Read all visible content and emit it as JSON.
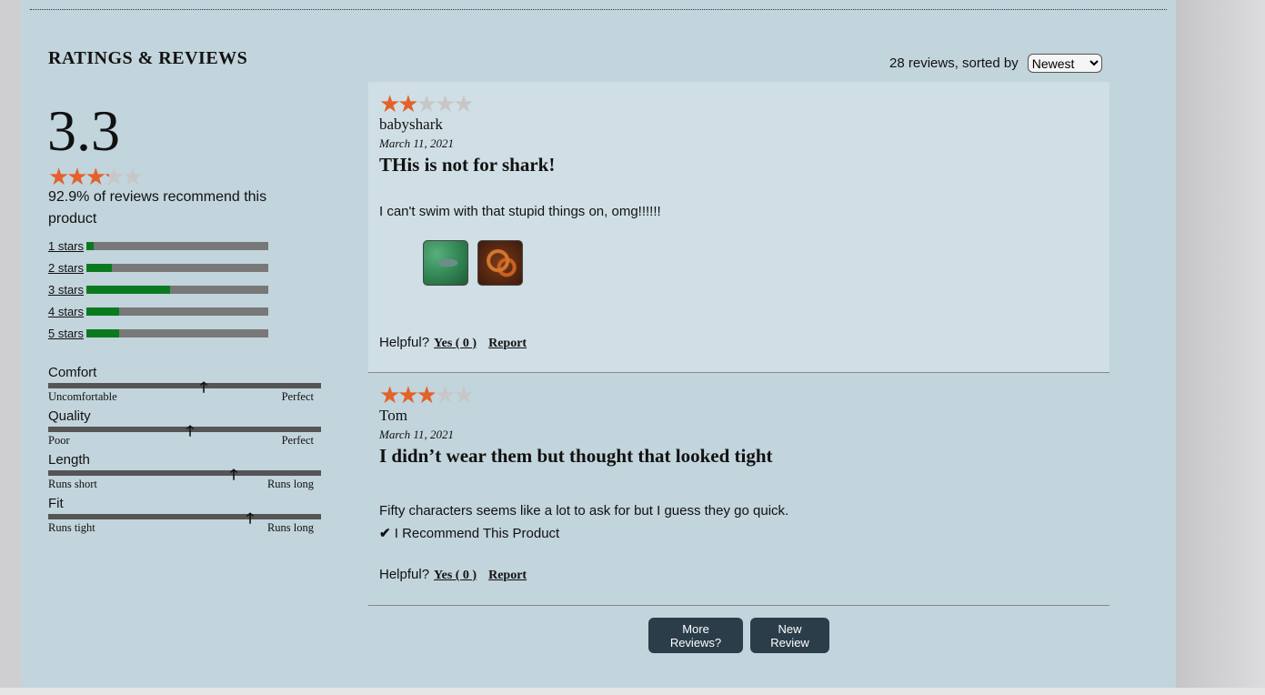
{
  "section_title": "RATINGS & REVIEWS",
  "summary": {
    "average": "3.3",
    "average_value": 3.3,
    "recommend_text": "92.9% of reviews recommend this product"
  },
  "breakdown": [
    {
      "label": "1 stars",
      "fraction": 0.04
    },
    {
      "label": "2 stars",
      "fraction": 0.14
    },
    {
      "label": "3 stars",
      "fraction": 0.46
    },
    {
      "label": "4 stars",
      "fraction": 0.18
    },
    {
      "label": "5 stars",
      "fraction": 0.18
    }
  ],
  "characteristics": [
    {
      "name": "Comfort",
      "low": "Uncomfortable",
      "high": "Perfect",
      "value": 0.57
    },
    {
      "name": "Quality",
      "low": "Poor",
      "high": "Perfect",
      "value": 0.52
    },
    {
      "name": "Length",
      "low": "Runs short",
      "high": "Runs long",
      "value": 0.68
    },
    {
      "name": "Fit",
      "low": "Runs tight",
      "high": "Runs long",
      "value": 0.74
    }
  ],
  "sort": {
    "label": "28 reviews, sorted by",
    "selected": "Newest"
  },
  "reviews": [
    {
      "rating": 2,
      "user": "babyshark",
      "date": "March 11, 2021",
      "title": "THis is not for shark!",
      "body": "I can't swim with that stupid things on, omg!!!!!!",
      "helpful_label": "Helpful?",
      "yes_label": "Yes ( 0 )",
      "report_label": "Report"
    },
    {
      "rating": 3,
      "user": "Tom",
      "date": "March 11, 2021",
      "title": "I didn’t wear them but thought that looked tight",
      "body": "Fifty characters seems like a lot to ask for but I guess they go quick.",
      "recommend_label": "I Recommend This Product",
      "helpful_label": "Helpful?",
      "yes_label": "Yes ( 0 )",
      "report_label": "Report"
    }
  ],
  "buttons": {
    "more_reviews": "More Reviews?",
    "new_review": "New Review"
  },
  "colors": {
    "star_filled": "#e3622a",
    "star_empty": "#c7c7c7",
    "bar_fill": "#0b7a1f",
    "bar_track": "#787878",
    "button_bg": "#2b3d49",
    "panel_bg": "#c2d4dc"
  }
}
